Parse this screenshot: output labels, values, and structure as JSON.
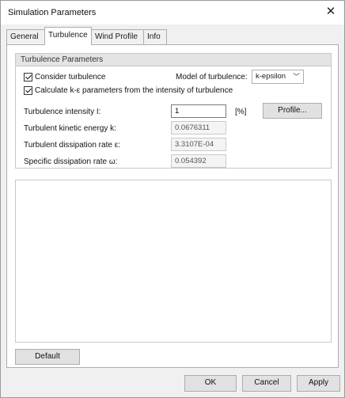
{
  "window": {
    "title": "Simulation Parameters"
  },
  "tabs": [
    {
      "label": "General"
    },
    {
      "label": "Turbulence"
    },
    {
      "label": "Wind Profile"
    },
    {
      "label": "Info"
    }
  ],
  "turbulence": {
    "group_title": "Turbulence Parameters",
    "consider_label": "Consider turbulence",
    "calculate_label": "Calculate k-ε parameters from the intensity of turbulence",
    "model_label": "Model of turbulence:",
    "model_value": "k-epsilon",
    "intensity_label": "Turbulence intensity I:",
    "intensity_value": "1",
    "intensity_unit": "[%]",
    "profile_button": "Profile...",
    "kinetic_label": "Turbulent kinetic energy k:",
    "kinetic_value": "0.0676311",
    "dissipation_label": "Turbulent dissipation rate ε:",
    "dissipation_value": "3.3107E-04",
    "specific_label": "Specific dissipation rate ω:",
    "specific_value": "0.054392"
  },
  "buttons": {
    "default": "Default",
    "ok": "OK",
    "cancel": "Cancel",
    "apply": "Apply"
  }
}
